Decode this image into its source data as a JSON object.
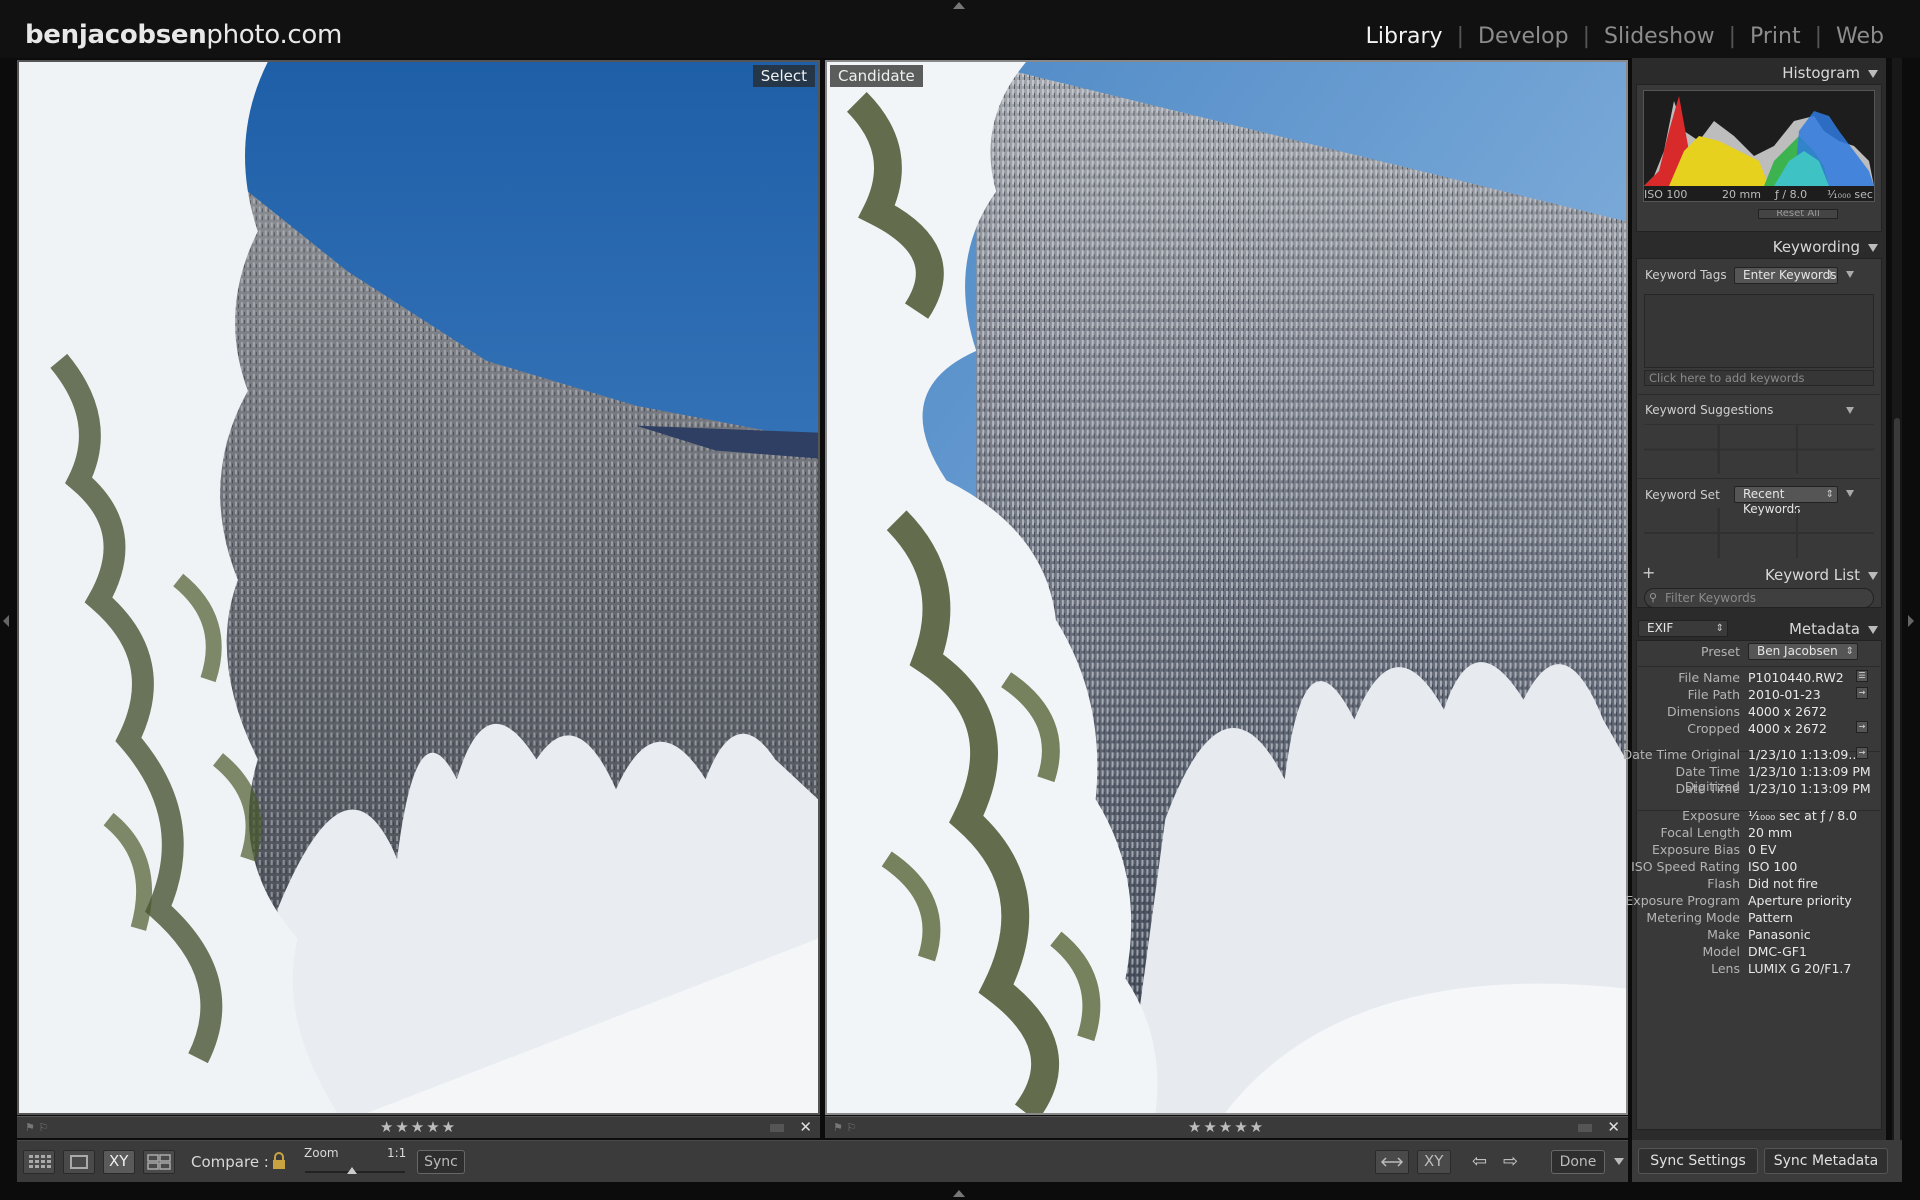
{
  "brand": {
    "bold": "benjacobsen",
    "rest": "photo.com"
  },
  "modules": [
    "Library",
    "Develop",
    "Slideshow",
    "Print",
    "Web"
  ],
  "active_module": "Library",
  "panes": {
    "left_label": "Select",
    "right_label": "Candidate",
    "stars": "★★★★★"
  },
  "toolbar": {
    "compare_label": "Compare :",
    "zoom_label": "Zoom",
    "zoom_value": "1:1",
    "sync_label": "Sync",
    "done_label": "Done",
    "xy_label": "XY"
  },
  "histogram": {
    "title": "Histogram",
    "iso": "ISO 100",
    "focal": "20 mm",
    "aperture": "ƒ / 8.0",
    "shutter": "¹⁄₁₀₀₀ sec",
    "reset": "Reset All"
  },
  "keywording": {
    "title": "Keywording",
    "tags_label": "Keyword Tags",
    "tags_value": "Enter Keywords",
    "click_hint": "Click here to add keywords",
    "suggestions_label": "Keyword Suggestions",
    "set_label": "Keyword Set",
    "set_value": "Recent Keywords"
  },
  "keyword_list": {
    "title": "Keyword List",
    "add": "+",
    "filter_placeholder": "Filter Keywords"
  },
  "metadata": {
    "title": "Metadata",
    "mode": "EXIF",
    "preset_label": "Preset",
    "preset_value": "Ben Jacobsen",
    "rows_file": [
      {
        "label": "File Name",
        "value": "P1010440.RW2"
      },
      {
        "label": "File Path",
        "value": "2010-01-23"
      },
      {
        "label": "Dimensions",
        "value": "4000 x 2672"
      },
      {
        "label": "Cropped",
        "value": "4000 x 2672"
      }
    ],
    "rows_date": [
      {
        "label": "Date Time Original",
        "value": "1/23/10 1:13:09..."
      },
      {
        "label": "Date Time Digitized",
        "value": "1/23/10 1:13:09 PM"
      },
      {
        "label": "Date Time",
        "value": "1/23/10 1:13:09 PM"
      }
    ],
    "rows_exif": [
      {
        "label": "Exposure",
        "value": "¹⁄₁₀₀₀ sec at ƒ / 8.0"
      },
      {
        "label": "Focal Length",
        "value": "20 mm"
      },
      {
        "label": "Exposure Bias",
        "value": "0 EV"
      },
      {
        "label": "ISO Speed Rating",
        "value": "ISO 100"
      },
      {
        "label": "Flash",
        "value": "Did not fire"
      },
      {
        "label": "Exposure Program",
        "value": "Aperture priority"
      },
      {
        "label": "Metering Mode",
        "value": "Pattern"
      },
      {
        "label": "Make",
        "value": "Panasonic"
      },
      {
        "label": "Model",
        "value": "DMC-GF1"
      },
      {
        "label": "Lens",
        "value": "LUMIX G 20/F1.7"
      }
    ]
  },
  "bottom_right": {
    "sync_settings": "Sync Settings",
    "sync_metadata": "Sync Metadata"
  }
}
